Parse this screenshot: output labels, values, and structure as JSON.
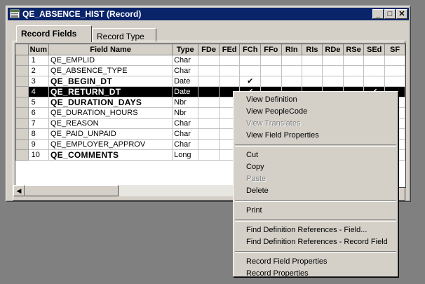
{
  "window": {
    "title": "QE_ABSENCE_HIST (Record)"
  },
  "tabs": [
    {
      "label": "Record Fields"
    },
    {
      "label": "Record Type"
    }
  ],
  "table": {
    "columns": [
      "Num",
      "Field Name",
      "Type",
      "FDe",
      "FEd",
      "FCh",
      "FFo",
      "RIn",
      "RIs",
      "RDe",
      "RSe",
      "SEd",
      "SF"
    ],
    "rows": [
      {
        "num": "1",
        "name": "QE_EMPLID",
        "type": "Char"
      },
      {
        "num": "2",
        "name": "QE_ABSENCE_TYPE",
        "type": "Char"
      },
      {
        "num": "3",
        "name": "QE_BEGIN_DT",
        "type": "Date"
      },
      {
        "num": "4",
        "name": "QE_RETURN_DT",
        "type": "Date"
      },
      {
        "num": "5",
        "name": "QE_DURATION_DAYS",
        "type": "Nbr"
      },
      {
        "num": "6",
        "name": "QE_DURATION_HOURS",
        "type": "Nbr"
      },
      {
        "num": "7",
        "name": "QE_REASON",
        "type": "Char"
      },
      {
        "num": "8",
        "name": "QE_PAID_UNPAID",
        "type": "Char"
      },
      {
        "num": "9",
        "name": "QE_EMPLOYER_APPROV",
        "type": "Char"
      },
      {
        "num": "10",
        "name": "QE_COMMENTS",
        "type": "Long"
      }
    ],
    "checkmark": "✔"
  },
  "context_menu": {
    "items": [
      "View Definition",
      "View PeopleCode",
      "View Translates",
      "View Field Properties",
      "Cut",
      "Copy",
      "Paste",
      "Delete",
      "Print",
      "Find Definition References - Field...",
      "Find Definition References - Record Field",
      "Record Field Properties",
      "Record Properties"
    ]
  }
}
